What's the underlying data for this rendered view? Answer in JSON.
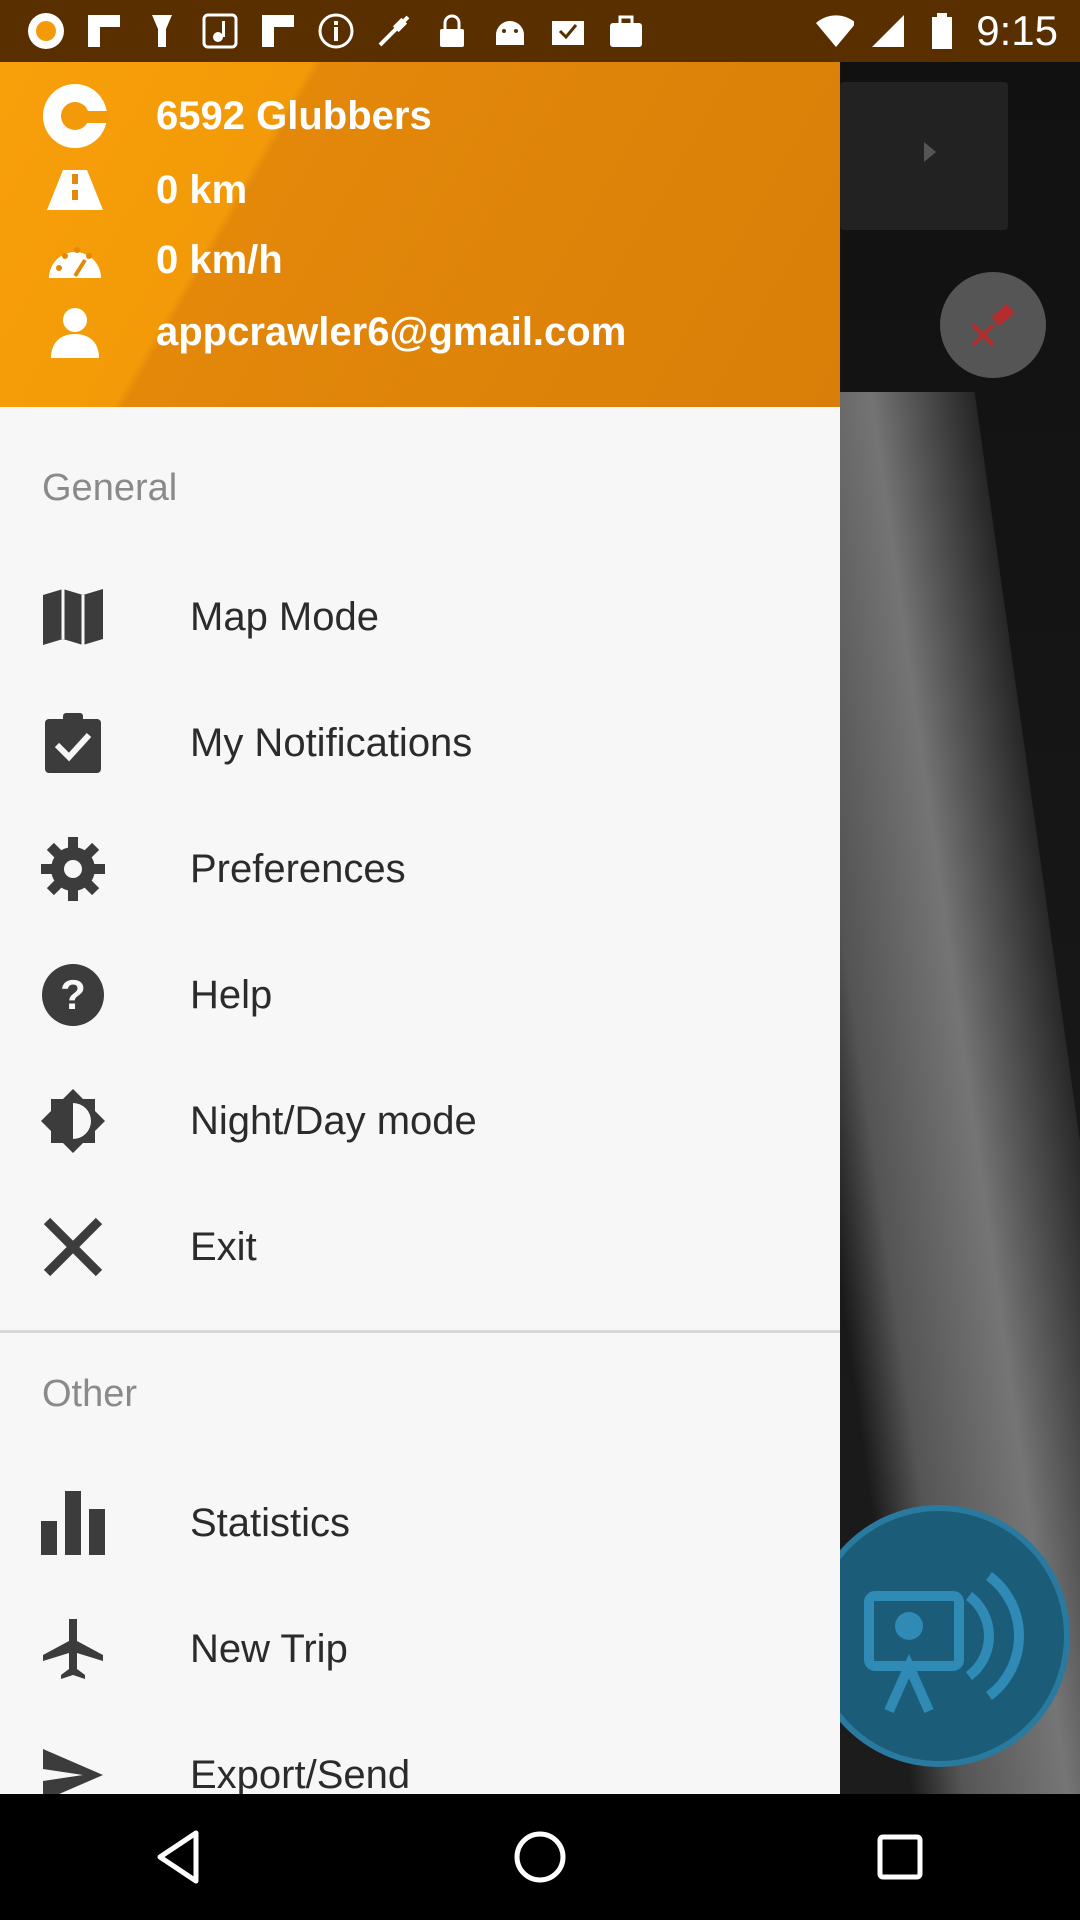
{
  "status_bar": {
    "time": "9:15",
    "icons": [
      "app-icon",
      "flipboard-icon",
      "flashlight-icon",
      "music-icon",
      "flipboard-icon",
      "info-icon",
      "fake-gps-icon",
      "lock-icon",
      "android-icon",
      "inbox-check-icon",
      "briefcase-icon"
    ],
    "right_icons": [
      "wifi-icon",
      "signal-icon",
      "battery-icon"
    ]
  },
  "header": {
    "points": "6592 Glubbers",
    "distance": "0 km",
    "speed": "0 km/h",
    "email": "appcrawler6@gmail.com"
  },
  "sections": {
    "general": "General",
    "other": "Other"
  },
  "menu_general": [
    {
      "label": "Map Mode",
      "icon": "map-icon"
    },
    {
      "label": "My Notifications",
      "icon": "clipboard-check-icon"
    },
    {
      "label": "Preferences",
      "icon": "gear-icon"
    },
    {
      "label": "Help",
      "icon": "help-icon"
    },
    {
      "label": "Night/Day mode",
      "icon": "brightness-icon"
    },
    {
      "label": "Exit",
      "icon": "close-icon"
    }
  ],
  "menu_other": [
    {
      "label": "Statistics",
      "icon": "bar-chart-icon"
    },
    {
      "label": "New Trip",
      "icon": "airplane-icon"
    },
    {
      "label": "Export/Send",
      "icon": "send-icon"
    }
  ],
  "colors": {
    "header_orange": "#f39a08",
    "drawer_bg": "#f7f7f7",
    "icon_dark": "#3c3c3c",
    "camera_blue": "#1b5d79"
  }
}
